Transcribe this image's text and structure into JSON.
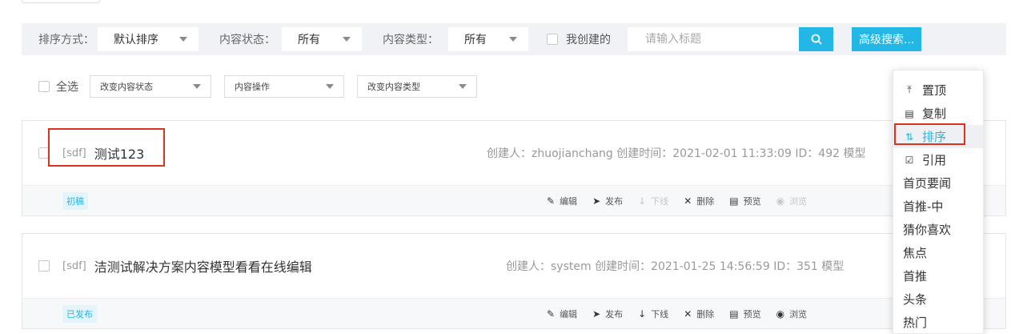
{
  "filter": {
    "sort_label": "排序方式：",
    "sort_value": "默认排序",
    "status_label": "内容状态：",
    "status_value": "所有",
    "type_label": "内容类型：",
    "type_value": "所有",
    "mine_label": "我创建的",
    "search_placeholder": "请输入标题",
    "advanced_label": "高级搜索..."
  },
  "batch": {
    "select_all": "全选",
    "change_status": "改变内容状态",
    "content_ops": "内容操作",
    "change_type": "改变内容类型"
  },
  "items": [
    {
      "tag": "[sdf]",
      "title": "测试123",
      "meta": "创建人：zhuojianchang  创建时间：2021-02-01 11:33:09     ID：492     模型",
      "status": "初稿",
      "actions": [
        {
          "icon": "✎",
          "label": "编辑"
        },
        {
          "icon": "➤",
          "label": "发布"
        },
        {
          "icon": "↓",
          "label": "下线"
        },
        {
          "icon": "✕",
          "label": "删除"
        },
        {
          "icon": "▤",
          "label": "预览"
        },
        {
          "icon": "◉",
          "label": "浏览"
        }
      ]
    },
    {
      "tag": "[sdf]",
      "title": "洁测试解决方案内容模型看看在线编辑",
      "meta": "创建人：system    创建时间：2021-01-25 14:56:59     ID：351     模型",
      "status": "已发布",
      "actions": [
        {
          "icon": "✎",
          "label": "编辑"
        },
        {
          "icon": "➤",
          "label": "发布"
        },
        {
          "icon": "↓",
          "label": "下线"
        },
        {
          "icon": "✕",
          "label": "删除"
        },
        {
          "icon": "▤",
          "label": "预览"
        },
        {
          "icon": "◉",
          "label": "浏览"
        }
      ]
    }
  ],
  "menu": [
    {
      "icon": "⤒",
      "label": "置顶"
    },
    {
      "icon": "▤",
      "label": "复制"
    },
    {
      "icon": "⇅",
      "label": "排序"
    },
    {
      "icon": "☑",
      "label": "引用"
    },
    {
      "icon": "",
      "label": "首页要闻"
    },
    {
      "icon": "",
      "label": "首推-中"
    },
    {
      "icon": "",
      "label": "猜你喜欢"
    },
    {
      "icon": "",
      "label": "焦点"
    },
    {
      "icon": "",
      "label": "首推"
    },
    {
      "icon": "",
      "label": "头条"
    },
    {
      "icon": "",
      "label": "热门"
    }
  ],
  "colors": {
    "accent": "#23b7e5",
    "highlight": "#e0301e"
  }
}
